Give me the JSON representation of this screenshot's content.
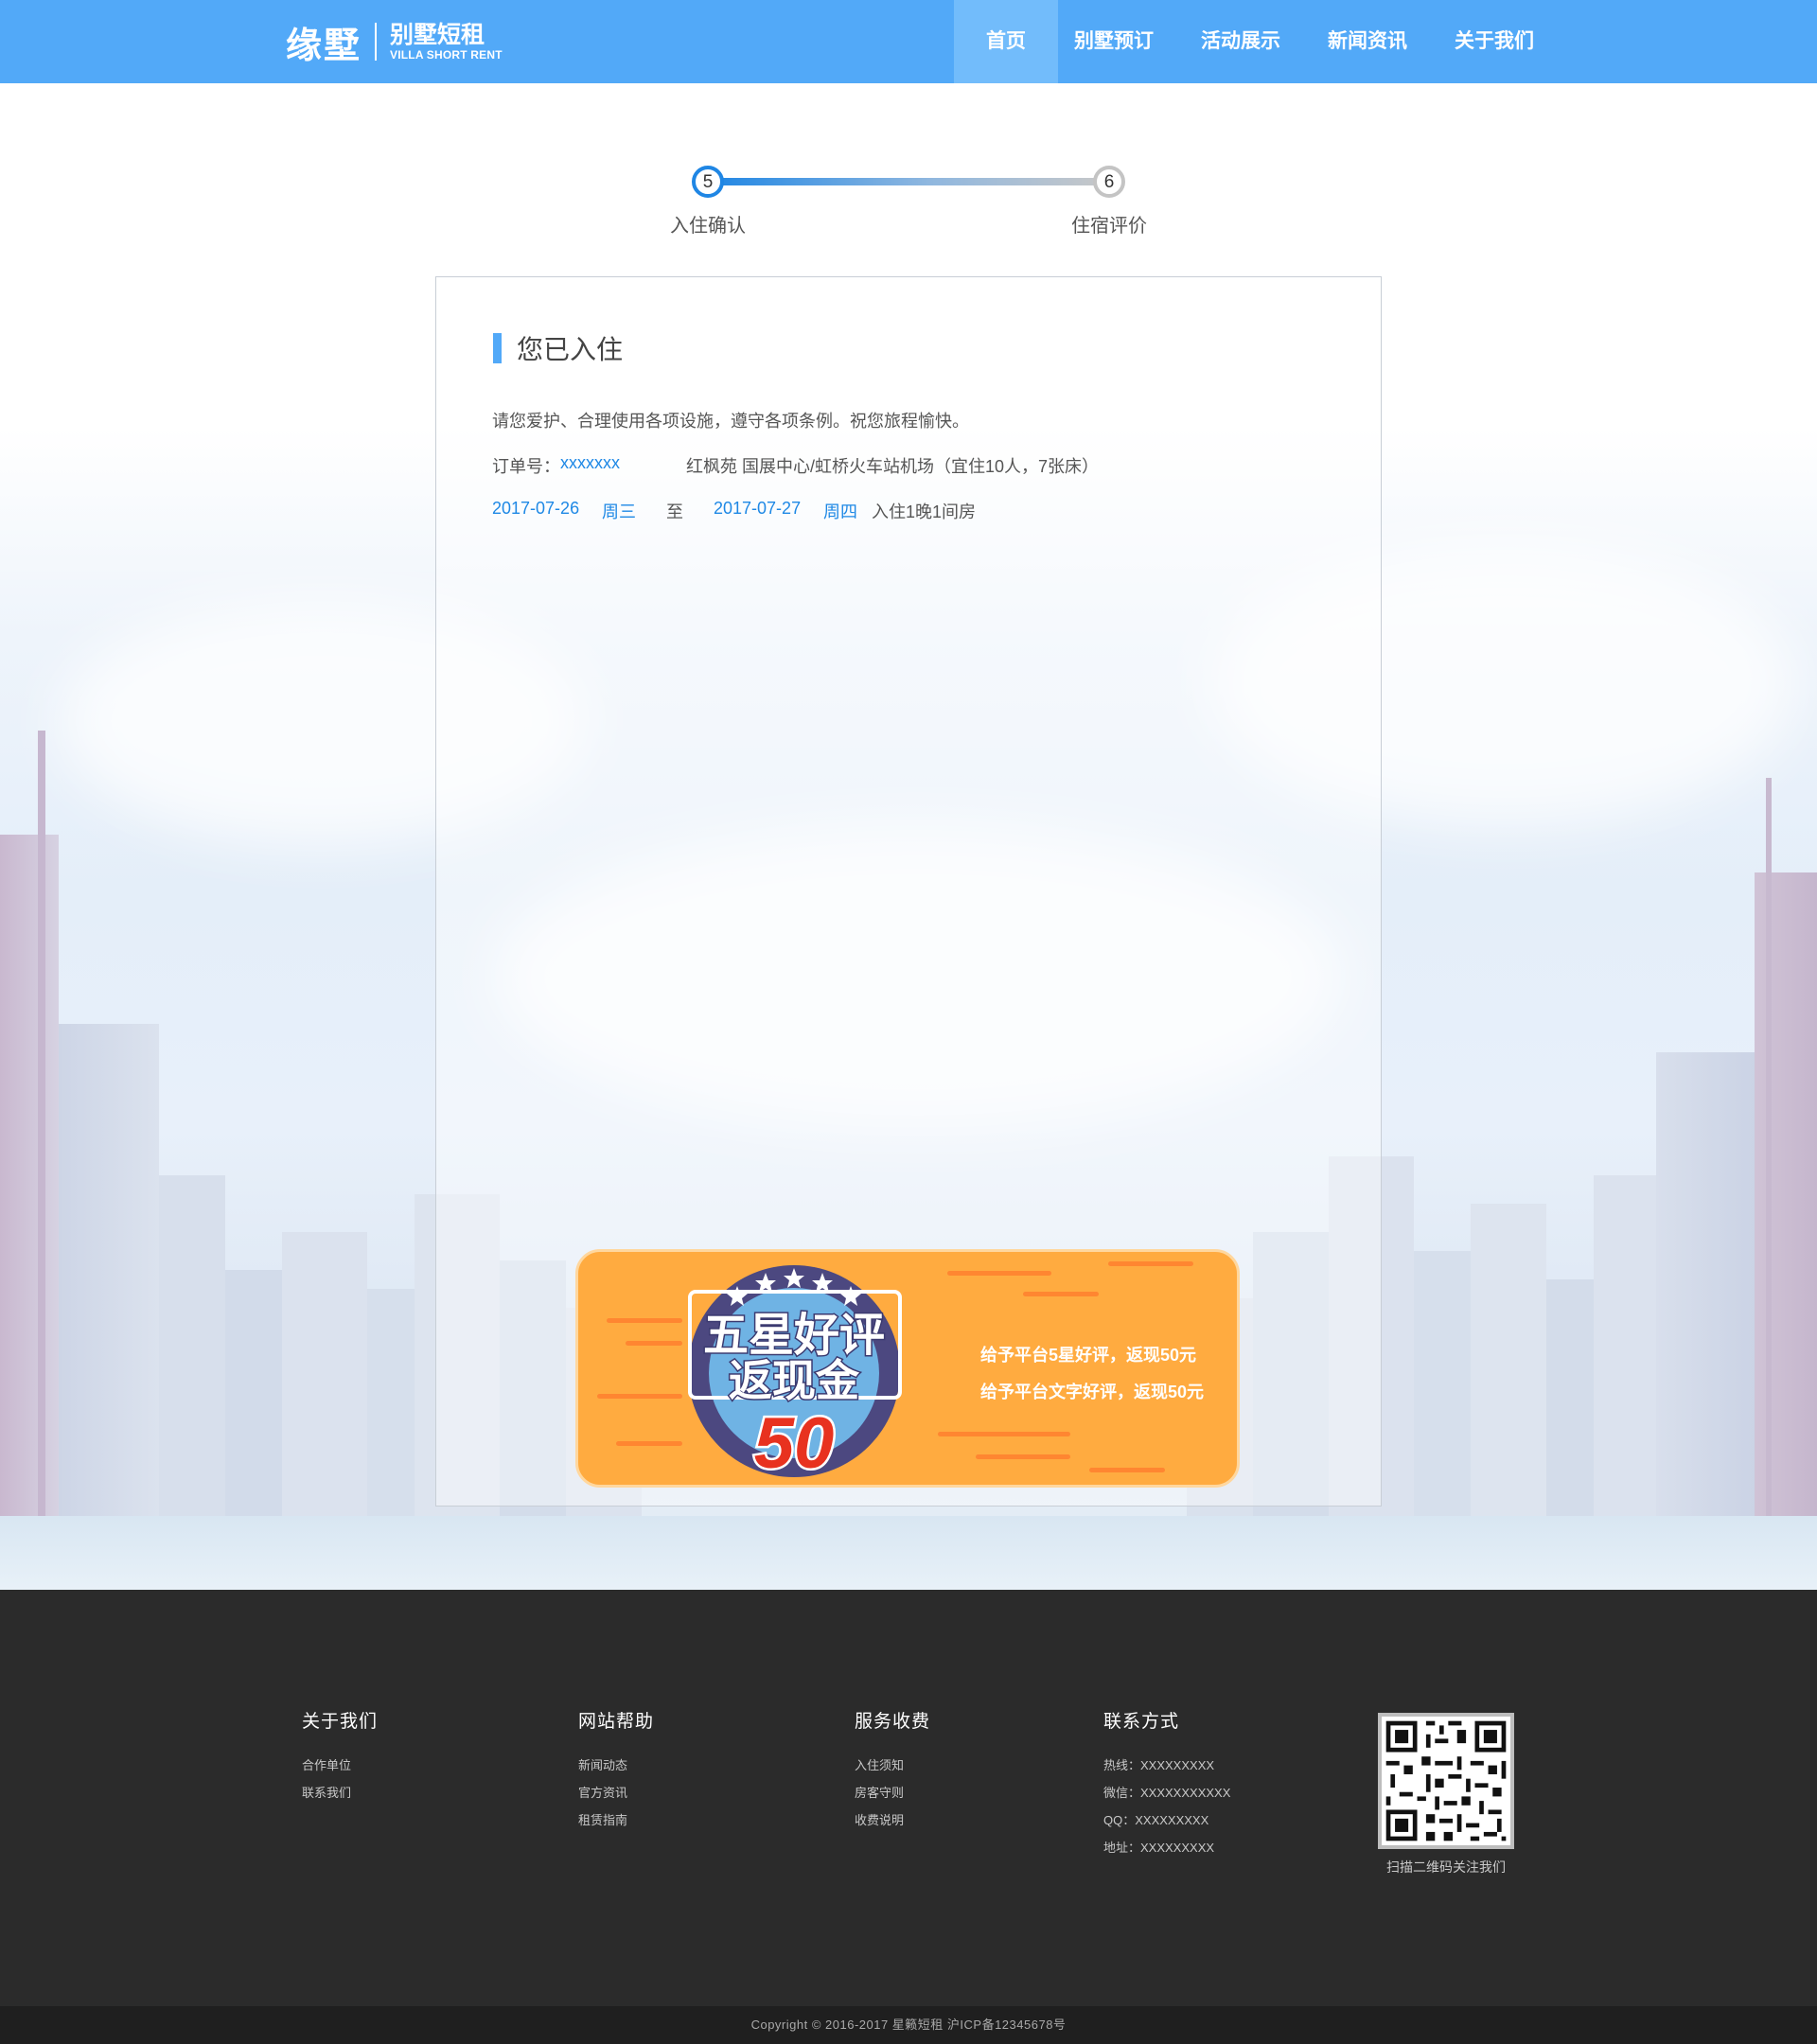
{
  "header": {
    "logo_main": "缘墅",
    "logo_sub_cn": "别墅短租",
    "logo_sub_en": "VILLA SHORT RENT",
    "nav": [
      {
        "label": "首页",
        "active": true
      },
      {
        "label": "别墅预订",
        "active": false
      },
      {
        "label": "活动展示",
        "active": false
      },
      {
        "label": "新闻资讯",
        "active": false
      },
      {
        "label": "关于我们",
        "active": false
      }
    ],
    "accent_color": "#52a9f8"
  },
  "steps": [
    {
      "number": "5",
      "label": "入住确认",
      "state": "current"
    },
    {
      "number": "6",
      "label": "住宿评价",
      "state": "pending"
    }
  ],
  "card": {
    "title": "您已入住",
    "notice": "请您爱护、合理使用各项设施，遵守各项条例。祝您旅程愉快。",
    "order_label": "订单号：",
    "order_number": "xxxxxxx",
    "property": "红枫苑 国展中心/虹桥火车站机场（宜住10人，7张床）",
    "checkin_date": "2017-07-26",
    "checkin_weekday": "周三",
    "to": "至",
    "checkout_date": "2017-07-27",
    "checkout_weekday": "周四",
    "stay_summary": "入住1晚1间房"
  },
  "promo": {
    "badge_line1": "五星好评",
    "badge_line2": "返现金",
    "badge_amount": "50",
    "line1": "给予平台5星好评，返现50元",
    "line2": "给予平台文字好评，返现50元"
  },
  "footer": {
    "columns": [
      {
        "heading": "关于我们",
        "links": [
          "合作单位",
          "联系我们"
        ]
      },
      {
        "heading": "网站帮助",
        "links": [
          "新闻动态",
          "官方资讯",
          "租赁指南"
        ]
      },
      {
        "heading": "服务收费",
        "links": [
          "入住须知",
          "房客守则",
          "收费说明"
        ]
      },
      {
        "heading": "联系方式",
        "links": [
          "热线：XXXXXXXXX",
          "微信：XXXXXXXXXXX",
          "QQ：XXXXXXXXX",
          "地址：XXXXXXXXX"
        ]
      }
    ],
    "qr_caption": "扫描二维码关注我们",
    "copyright": "Copyright © 2016-2017 星籁短租 沪ICP备12345678号"
  }
}
